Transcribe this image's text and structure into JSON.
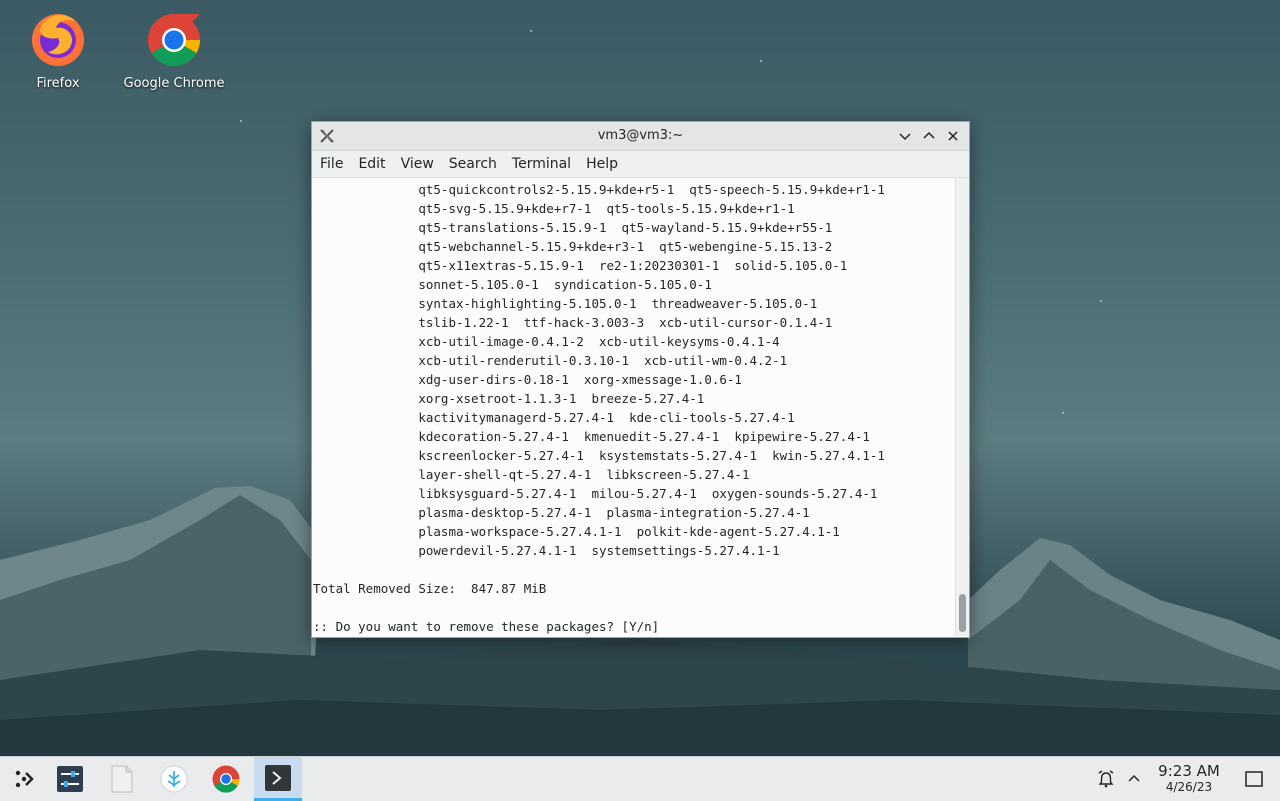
{
  "desktop": {
    "icons": [
      {
        "label": "Firefox"
      },
      {
        "label": "Google Chrome"
      }
    ]
  },
  "window": {
    "title": "vm3@vm3:~",
    "menu": [
      "File",
      "Edit",
      "View",
      "Search",
      "Terminal",
      "Help"
    ],
    "terminal_lines": [
      "              qt5-quickcontrols2-5.15.9+kde+r5-1  qt5-speech-5.15.9+kde+r1-1",
      "              qt5-svg-5.15.9+kde+r7-1  qt5-tools-5.15.9+kde+r1-1",
      "              qt5-translations-5.15.9-1  qt5-wayland-5.15.9+kde+r55-1",
      "              qt5-webchannel-5.15.9+kde+r3-1  qt5-webengine-5.15.13-2",
      "              qt5-x11extras-5.15.9-1  re2-1:20230301-1  solid-5.105.0-1",
      "              sonnet-5.105.0-1  syndication-5.105.0-1",
      "              syntax-highlighting-5.105.0-1  threadweaver-5.105.0-1",
      "              tslib-1.22-1  ttf-hack-3.003-3  xcb-util-cursor-0.1.4-1",
      "              xcb-util-image-0.4.1-2  xcb-util-keysyms-0.4.1-4",
      "              xcb-util-renderutil-0.3.10-1  xcb-util-wm-0.4.2-1",
      "              xdg-user-dirs-0.18-1  xorg-xmessage-1.0.6-1",
      "              xorg-xsetroot-1.1.3-1  breeze-5.27.4-1",
      "              kactivitymanagerd-5.27.4-1  kde-cli-tools-5.27.4-1",
      "              kdecoration-5.27.4-1  kmenuedit-5.27.4-1  kpipewire-5.27.4-1",
      "              kscreenlocker-5.27.4-1  ksystemstats-5.27.4-1  kwin-5.27.4.1-1",
      "              layer-shell-qt-5.27.4-1  libkscreen-5.27.4-1",
      "              libksysguard-5.27.4-1  milou-5.27.4-1  oxygen-sounds-5.27.4-1",
      "              plasma-desktop-5.27.4-1  plasma-integration-5.27.4-1",
      "              plasma-workspace-5.27.4.1-1  polkit-kde-agent-5.27.4.1-1",
      "              powerdevil-5.27.4.1-1  systemsettings-5.27.4.1-1",
      "",
      "Total Removed Size:  847.87 MiB",
      "",
      ":: Do you want to remove these packages? [Y/n]"
    ]
  },
  "taskbar": {
    "clock": {
      "time": "9:23 AM",
      "date": "4/26/23"
    }
  },
  "colors": {
    "accent": "#3daee9",
    "firefox_orange": "#ff7139",
    "chrome_blue": "#1a73e8"
  }
}
